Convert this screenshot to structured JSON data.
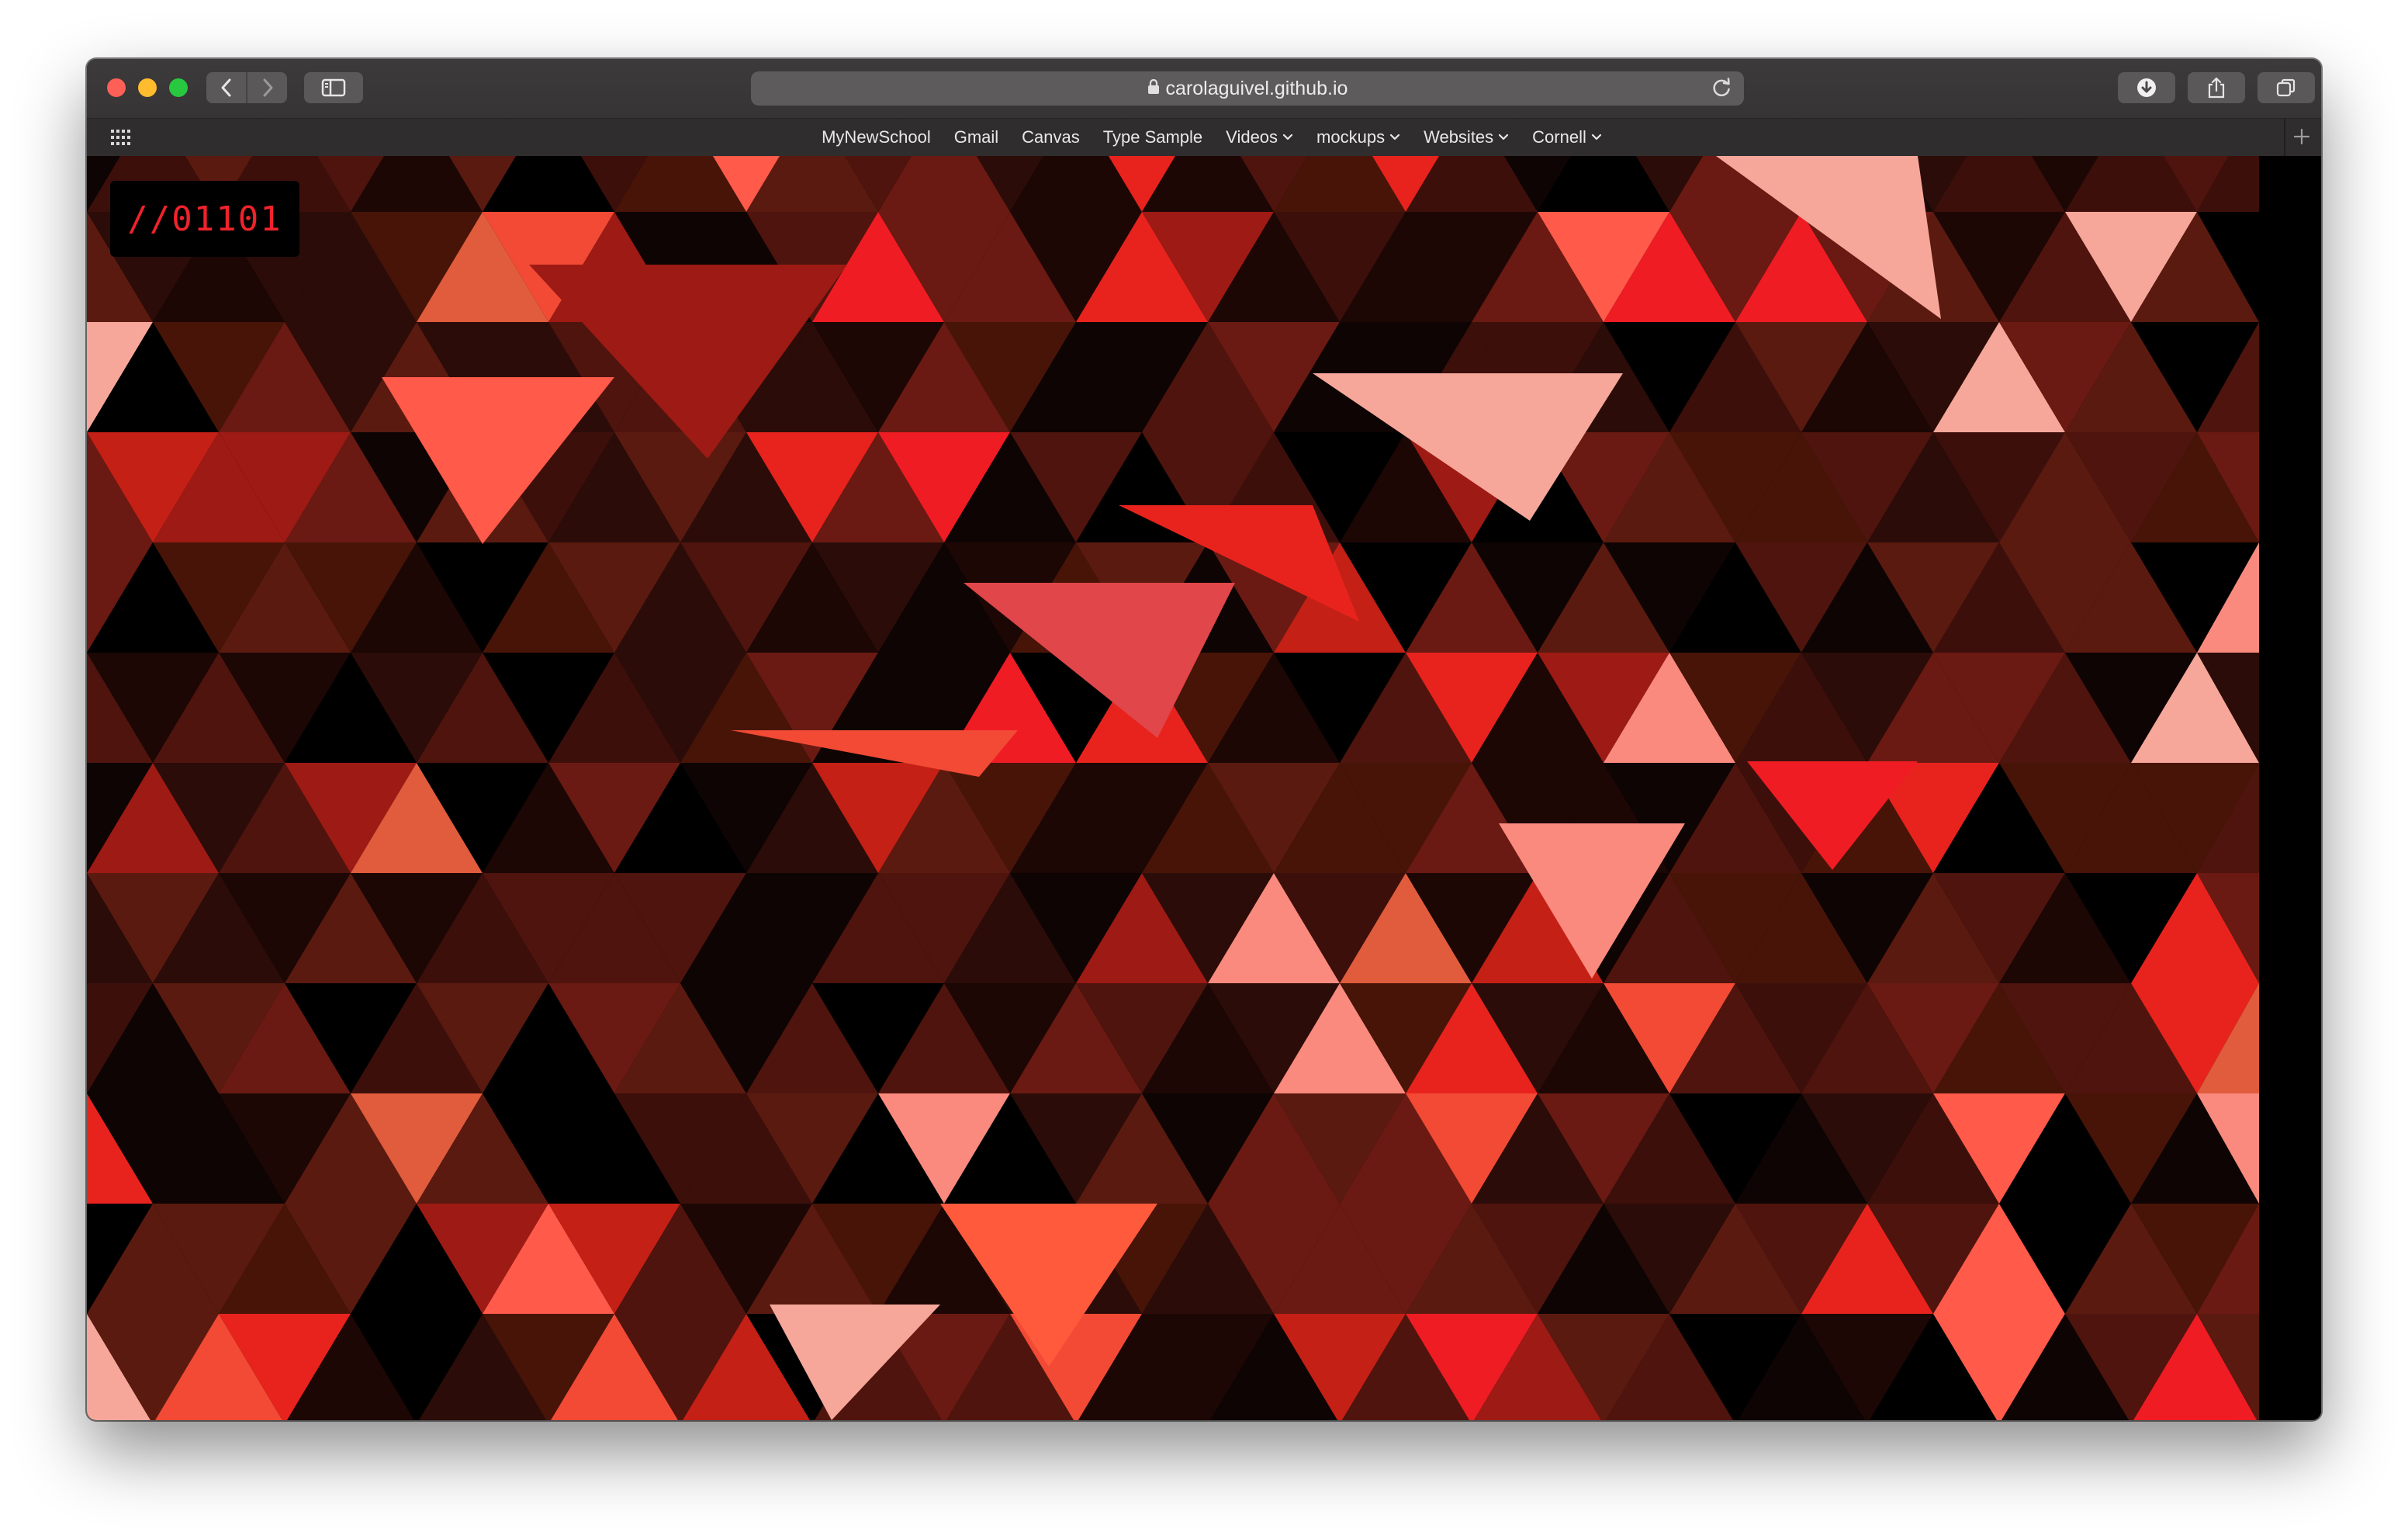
{
  "browser": {
    "address": "carolaguivel.github.io"
  },
  "favorites": [
    {
      "label": "MyNewSchool",
      "menu": false
    },
    {
      "label": "Gmail",
      "menu": false
    },
    {
      "label": "Canvas",
      "menu": false
    },
    {
      "label": "Type Sample",
      "menu": false
    },
    {
      "label": "Videos",
      "menu": true
    },
    {
      "label": "mockups",
      "menu": true
    },
    {
      "label": "Websites",
      "menu": true
    },
    {
      "label": "Cornell",
      "menu": true
    }
  ],
  "page": {
    "logo_text": "//01101",
    "colors": {
      "background": "#000000",
      "accent": "#f0222c",
      "palette_dark": [
        "#000000",
        "#0d0403",
        "#1c0705",
        "#2b0c08",
        "#3d0f0b",
        "#4f140d",
        "#5b1a10",
        "#481408",
        "#6a1a12"
      ],
      "palette_bright": [
        "#9e1a14",
        "#c42016",
        "#e8231d",
        "#f24a34",
        "#ff5a4a",
        "#f98a7d",
        "#f6a79a",
        "#e05c3c",
        "#ef1c24"
      ]
    }
  },
  "icons": {
    "back": "chevron-left-icon",
    "forward": "chevron-right-icon",
    "sidebar": "sidebar-icon",
    "lock": "lock-icon",
    "reload": "reload-icon",
    "download": "download-icon",
    "share": "share-icon",
    "tabs": "tab-overview-icon",
    "grid": "grid-icon",
    "new_tab": "plus-icon"
  }
}
